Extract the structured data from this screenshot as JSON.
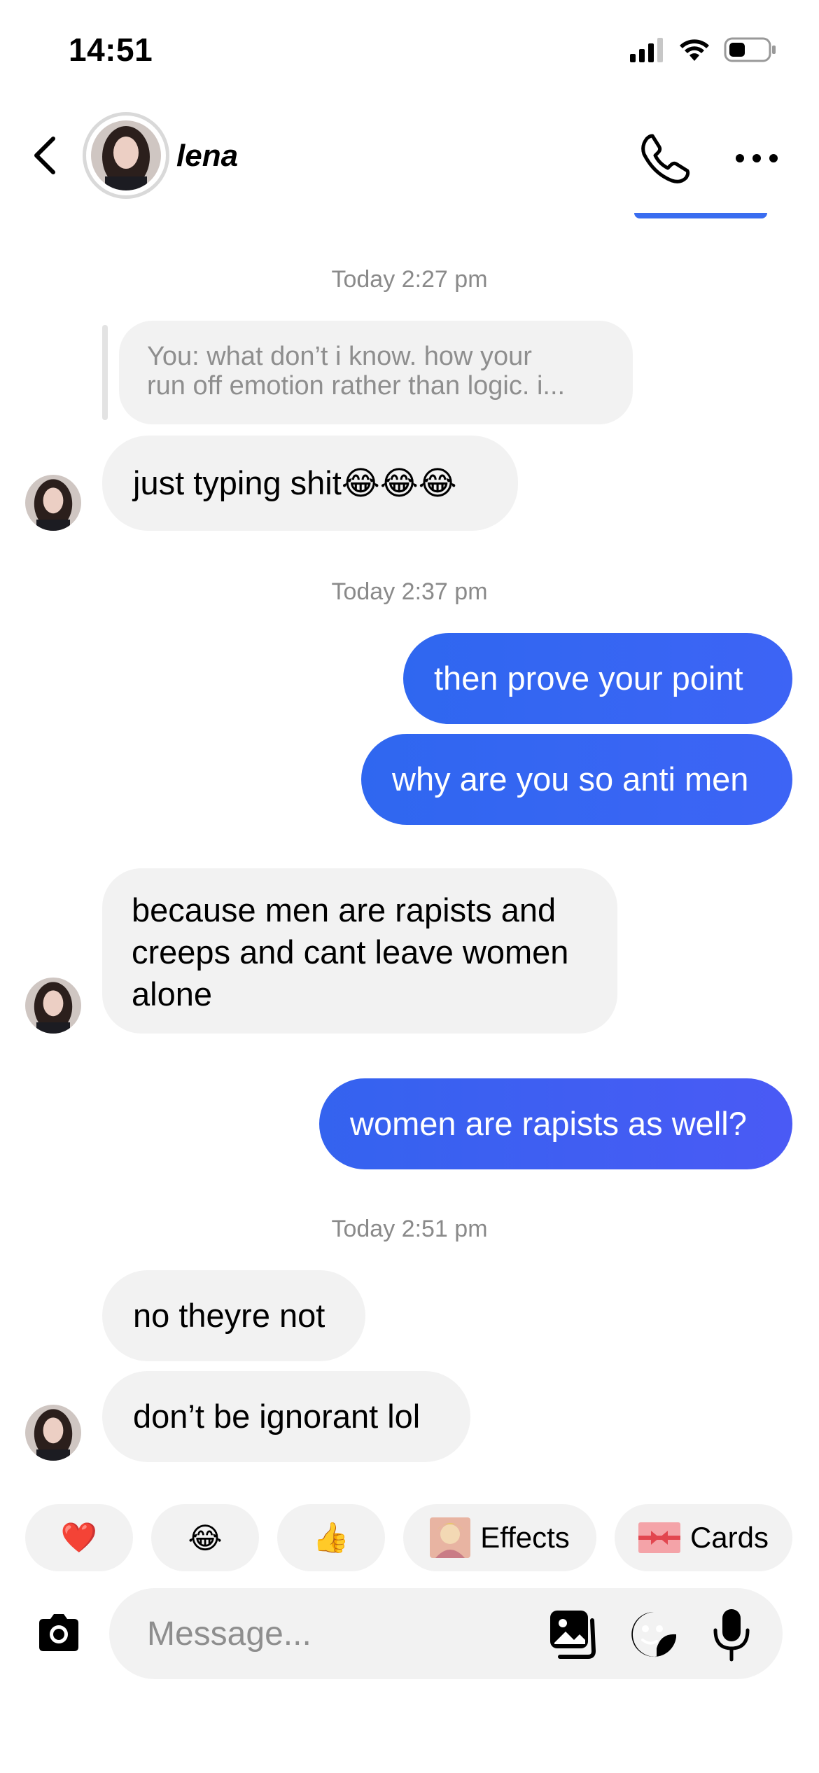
{
  "status_bar": {
    "time": "14:51"
  },
  "header": {
    "contact_name": "lena"
  },
  "timestamps": [
    "Today 2:27 pm",
    "Today 2:37 pm",
    "Today 2:51 pm"
  ],
  "reply_preview": {
    "line1": "You: what don’t i know. how your",
    "line2": "run off emotion rather than logic. i..."
  },
  "messages": [
    {
      "from": "them",
      "text": "just typing shit😂😂😂"
    },
    {
      "from": "me",
      "text": "then prove your point"
    },
    {
      "from": "me",
      "text": "why are you so anti men"
    },
    {
      "from": "them",
      "line1": "because men are rapists and",
      "line2": "creeps and cant leave women",
      "line3": "alone"
    },
    {
      "from": "me",
      "text": "women are rapists as well?"
    },
    {
      "from": "them",
      "text": "no theyre not"
    },
    {
      "from": "them",
      "text": "don’t be ignorant lol"
    }
  ],
  "quick_replies": {
    "heart": "❤️",
    "laugh": "😂",
    "thumbs": "👍",
    "effects": "Effects",
    "cards": "Cards"
  },
  "composer": {
    "placeholder": "Message..."
  },
  "colors": {
    "accent": "#3a6df0",
    "incoming_bubble": "#f2f2f2",
    "outgoing_bubble": "#2f67f0"
  }
}
